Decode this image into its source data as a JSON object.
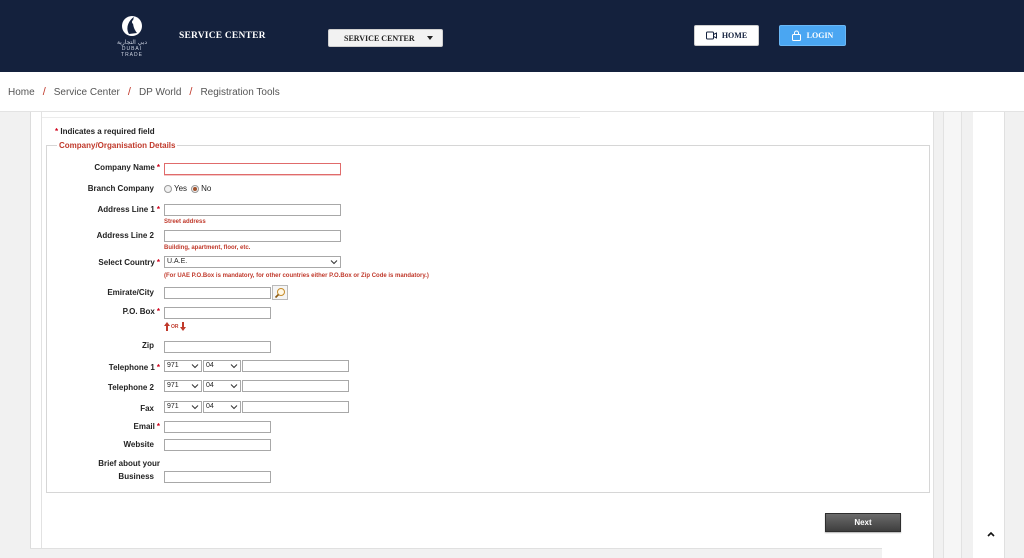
{
  "header": {
    "logo_arabic": "دبي التجارية",
    "logo_english": "DUBAI TRADE",
    "site_title": "SERVICE CENTER",
    "service_select": "SERVICE CENTER",
    "home_label": "HOME",
    "login_label": "LOGIN",
    "brand_color": "#14213d",
    "login_color": "#4aa6f2"
  },
  "breadcrumb": [
    "Home",
    "Service Center",
    "DP World",
    "Registration Tools"
  ],
  "form": {
    "required_note": "Indicates a required field",
    "required_marker": "*",
    "legend": "Company/Organisation Details",
    "labels": {
      "company_name": "Company Name",
      "branch_company": "Branch Company",
      "address_line1": "Address Line 1",
      "address_line2": "Address Line 2",
      "select_country": "Select Country",
      "emirate_city": "Emirate/City",
      "po_box": "P.O. Box",
      "zip": "Zip",
      "telephone1": "Telephone 1",
      "telephone2": "Telephone 2",
      "fax": "Fax",
      "email": "Email",
      "website": "Website",
      "brief_line1": "Brief about your",
      "brief_line2": "Business"
    },
    "branch_options": [
      "Yes",
      "No"
    ],
    "branch_selected": "No",
    "hints": {
      "address_line1": "Street address",
      "address_line2": "Building, apartment, floor, etc.",
      "country": "(For UAE P.O.Box is mandatory, for other countries either P.O.Box or Zip Code is mandatory.)"
    },
    "country_value": "U.A.E.",
    "or_label": "OR",
    "phone_country_code": "971",
    "phone_area_code": "04",
    "next_label": "Next"
  }
}
